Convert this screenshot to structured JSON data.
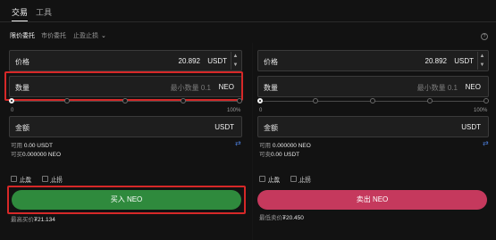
{
  "top_tabs": {
    "trade": "交易",
    "tools": "工具"
  },
  "order_tabs": {
    "limit": "限价委托",
    "market": "市价委托",
    "tpsl": "止盈止损",
    "tpsl_chevron": "⌄"
  },
  "buy": {
    "price": {
      "label": "价格",
      "value": "20.892",
      "unit": "USDT"
    },
    "amount": {
      "label": "数量",
      "placeholder": "最小数量 0.1",
      "unit": "NEO"
    },
    "slider": {
      "min": "0",
      "max": "100%",
      "level": 0
    },
    "total": {
      "label": "金额",
      "unit": "USDT"
    },
    "available": {
      "label": "可用",
      "value": "0.00 USDT"
    },
    "can_buy": {
      "label": "可买",
      "value": "0.000000 NEO"
    },
    "take_profit": "止盈",
    "stop_loss": "止损",
    "button": "买入 NEO",
    "below": {
      "label": "最高买价",
      "value": "₮21.134"
    }
  },
  "sell": {
    "price": {
      "label": "价格",
      "value": "20.892",
      "unit": "USDT"
    },
    "amount": {
      "label": "数量",
      "placeholder": "最小数量 0.1",
      "unit": "NEO"
    },
    "slider": {
      "min": "0",
      "max": "100%",
      "level": 0
    },
    "total": {
      "label": "金额",
      "unit": "USDT"
    },
    "available": {
      "label": "可用",
      "value": "0.000000 NEO"
    },
    "can_sell": {
      "label": "可卖",
      "value": "0.00 USDT"
    },
    "take_profit": "止盈",
    "stop_loss": "止损",
    "button": "卖出 NEO",
    "below": {
      "label": "最低卖价",
      "value": "₮20.450"
    }
  },
  "icons": {
    "stepper_up": "▲",
    "stepper_down": "▼",
    "swap": "⇄",
    "info": "?"
  },
  "colors": {
    "buy": "#2f8a3d",
    "sell": "#c5395d",
    "highlight": "#d62828",
    "link": "#4a7bd6"
  }
}
